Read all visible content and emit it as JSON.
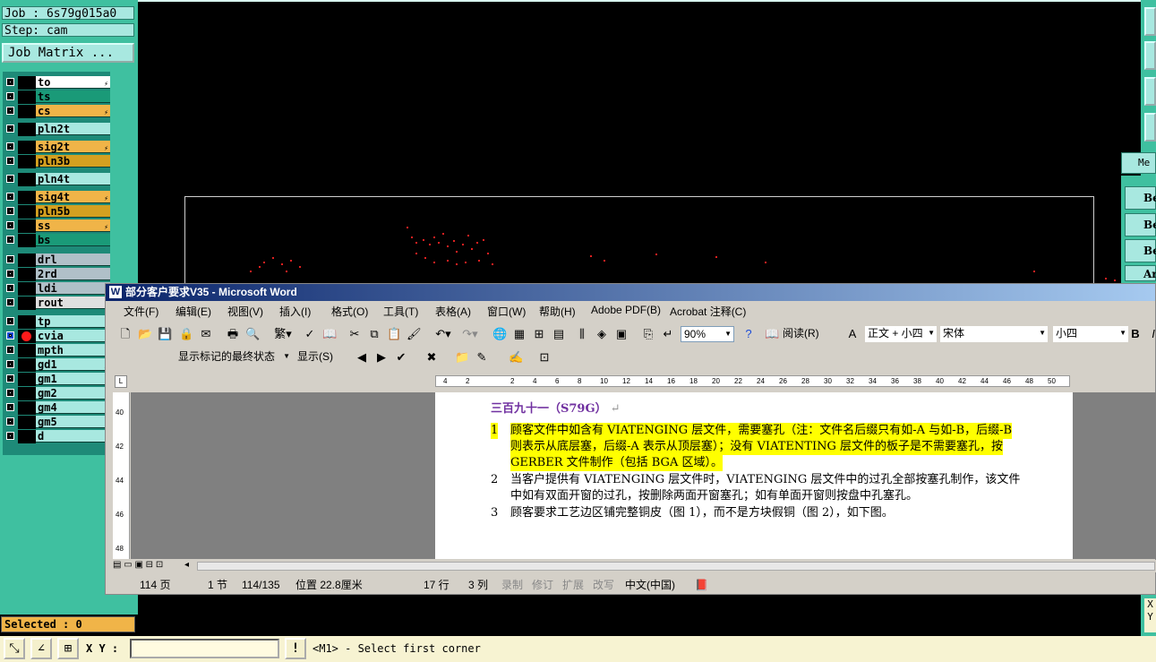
{
  "cam": {
    "job_label": "Job : 6s79g015a0",
    "step_label": "Step: cam",
    "job_matrix_button": "Job Matrix ...",
    "selected_label": "Selected : 0",
    "layers": [
      {
        "name": "to",
        "color": "#ffffff",
        "bolt": true
      },
      {
        "name": "ts",
        "color": "#1a9a78",
        "bolt": false
      },
      {
        "name": "cs",
        "color": "#f0b448",
        "bolt": true
      },
      {
        "name": "pln2t",
        "color": "#a8e8e0",
        "bolt": false
      },
      {
        "name": "sig2t",
        "color": "#f0b448",
        "bolt": true
      },
      {
        "name": "pln3b",
        "color": "#d4a020",
        "bolt": false
      },
      {
        "name": "pln4t",
        "color": "#a8e8e0",
        "bolt": false
      },
      {
        "name": "sig4t",
        "color": "#f0b448",
        "bolt": true
      },
      {
        "name": "pln5b",
        "color": "#d4a020",
        "bolt": false
      },
      {
        "name": "ss",
        "color": "#f0b448",
        "bolt": true
      },
      {
        "name": "bs",
        "color": "#1a9a78",
        "bolt": false
      },
      {
        "name": "drl",
        "color": "#b0c0c8",
        "bolt": false
      },
      {
        "name": "2rd",
        "color": "#b0c0c8",
        "bolt": false
      },
      {
        "name": "ldi",
        "color": "#b0c0c8",
        "bolt": false
      },
      {
        "name": "rout",
        "color": "#e0e0e0",
        "bolt": false
      },
      {
        "name": "tp",
        "color": "#a8e8e0",
        "bolt": false
      },
      {
        "name": "cvia",
        "color": "#a8e8e0",
        "bolt": false,
        "active": true
      },
      {
        "name": "mpth",
        "color": "#a8e8e0",
        "bolt": false
      },
      {
        "name": "gd1",
        "color": "#a8e8e0",
        "bolt": true
      },
      {
        "name": "gm1",
        "color": "#a8e8e0",
        "bolt": false
      },
      {
        "name": "gm2",
        "color": "#a8e8e0",
        "bolt": false
      },
      {
        "name": "gm4",
        "color": "#a8e8e0",
        "bolt": false
      },
      {
        "name": "gm5",
        "color": "#a8e8e0",
        "bolt": false
      },
      {
        "name": "d",
        "color": "#a8e8e0",
        "bolt": false
      }
    ],
    "xy_label": "X Y :",
    "status_message": "<M1> - Select first corner",
    "right_list": [
      "Be",
      "Be",
      "Be",
      "Ar"
    ],
    "right_title": "Me",
    "xy_right": "X\nY"
  },
  "word": {
    "title": "部分客户要求V35 - Microsoft Word",
    "menus": [
      "文件(F)",
      "编辑(E)",
      "视图(V)",
      "插入(I)",
      "格式(O)",
      "工具(T)",
      "表格(A)",
      "窗口(W)",
      "帮助(H)",
      "Adobe PDF(B)",
      "Acrobat 注释(C)"
    ],
    "zoom": "90%",
    "read_button": "阅读(R)",
    "style": "正文 + 小四",
    "font": "宋体",
    "size": "小四",
    "markup_state": "显示标记的最终状态",
    "show_button": "显示(S)",
    "ruler_ticks": [
      "4",
      "2",
      "",
      "2",
      "4",
      "6",
      "8",
      "10",
      "12",
      "14",
      "16",
      "18",
      "20",
      "22",
      "24",
      "26",
      "28",
      "30",
      "32",
      "34",
      "36",
      "38",
      "40",
      "42",
      "44",
      "46",
      "48",
      "50"
    ],
    "vruler_ticks": [
      "40",
      "42",
      "44",
      "46",
      "48"
    ],
    "heading": "三百九十一（S79G）",
    "items": [
      {
        "num": "1",
        "lines": [
          "顾客文件中如含有 VIATENGING 层文件，需要塞孔（注：文件名后缀只有如-A 与如-B，后缀-B",
          "则表示从底层塞，后缀-A 表示从顶层塞）；没有 VIATENTING 层文件的板子是不需要塞孔，按",
          "GERBER 文件制作（包括 BGA 区域）。"
        ],
        "highlight": true
      },
      {
        "num": "2",
        "lines": [
          "当客户提供有 VIATENGING 层文件时，VIATENGING 层文件中的过孔全部按塞孔制作，该文件",
          "中如有双面开窗的过孔，按删除两面开窗塞孔；如有单面开窗则按盘中孔塞孔。"
        ],
        "highlight": false
      },
      {
        "num": "3",
        "lines": [
          "顾客要求工艺边区铺完整铜皮（图 1），而不是方块假铜（图 2），如下图。"
        ],
        "highlight": false
      }
    ],
    "status": {
      "page": "114 页",
      "section": "1 节",
      "pages": "114/135",
      "position": "位置 22.8厘米",
      "line": "17 行",
      "col": "3 列",
      "rec": "录制",
      "trk": "修订",
      "ext": "扩展",
      "ovr": "改写",
      "lang": "中文(中国)"
    }
  }
}
